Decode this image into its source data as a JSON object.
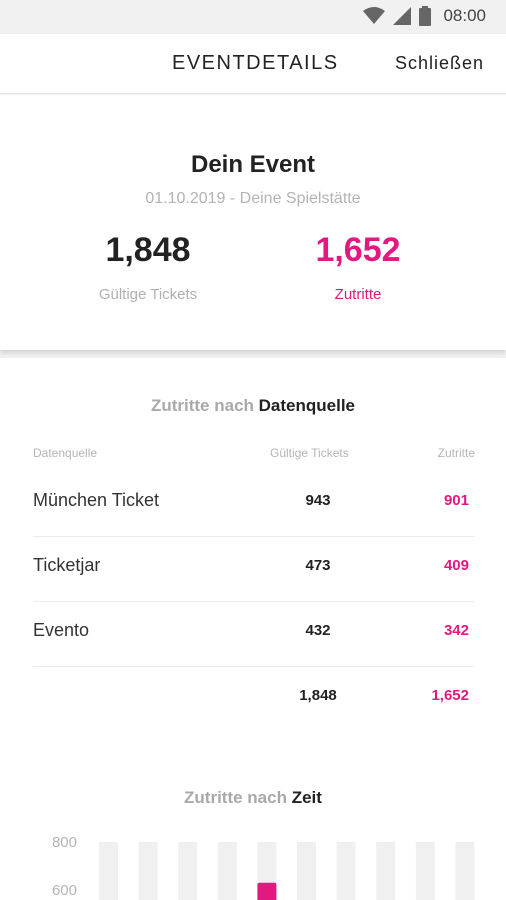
{
  "status": {
    "time": "08:00"
  },
  "appbar": {
    "title": "EVENTDETAILS",
    "close_label": "Schließen"
  },
  "event": {
    "name": "Dein Event",
    "subtitle": "01.10.2019 - Deine Spielstätte",
    "valid_tickets": {
      "value": "1,848",
      "label": "Gültige Tickets"
    },
    "entries": {
      "value": "1,652",
      "label": "Zutritte"
    }
  },
  "by_source": {
    "title_prefix": "Zutritte nach",
    "title_strong": "Datenquelle",
    "headers": {
      "source": "Datenquelle",
      "valid": "Gültige Tickets",
      "entries": "Zutritte"
    },
    "rows": [
      {
        "source": "München Ticket",
        "valid": "943",
        "entries": "901"
      },
      {
        "source": "Ticketjar",
        "valid": "473",
        "entries": "409"
      },
      {
        "source": "Evento",
        "valid": "432",
        "entries": "342"
      }
    ],
    "total": {
      "valid": "1,848",
      "entries": "1,652"
    }
  },
  "by_time": {
    "title_prefix": "Zutritte nach",
    "title_strong": "Zeit",
    "chart_data": {
      "type": "bar",
      "title": "Zutritte nach Zeit",
      "y_ticks": [
        800,
        600
      ],
      "ylim_visible": [
        600,
        800
      ],
      "bar_count": 10,
      "highlighted_bar_index": 4,
      "highlighted_value_approx": 630,
      "colors": {
        "track": "#f0f0f0",
        "bar": "#e2197e",
        "tick": "#b5b5b5"
      }
    }
  },
  "colors": {
    "accent": "#e2197e",
    "muted": "#b0b0b0"
  }
}
